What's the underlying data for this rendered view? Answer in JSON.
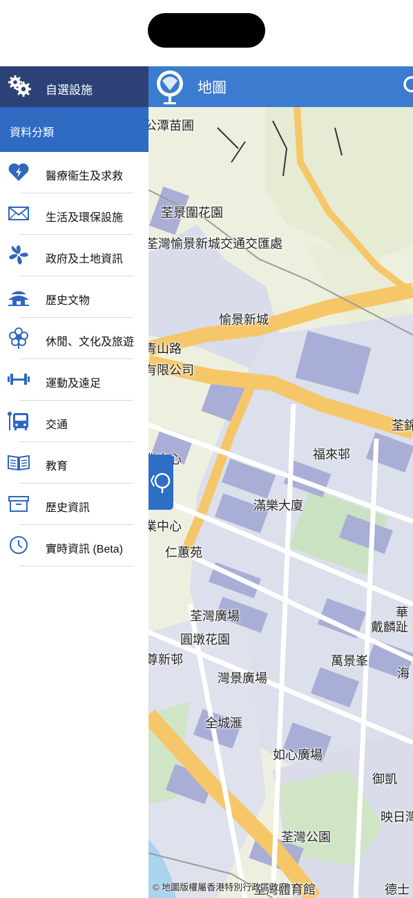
{
  "drawer": {
    "header_title": "自選設施",
    "category_label": "資料分類",
    "items": [
      {
        "label": "醫療衞生及求救",
        "icon": "medical-heart-icon"
      },
      {
        "label": "生活及環保設施",
        "icon": "envelope-icon"
      },
      {
        "label": "政府及土地資訊",
        "icon": "bauhinia-icon"
      },
      {
        "label": "歷史文物",
        "icon": "pagoda-icon"
      },
      {
        "label": "休閒、文化及旅遊",
        "icon": "flower-icon"
      },
      {
        "label": "運動及遠足",
        "icon": "dumbbell-icon"
      },
      {
        "label": "交通",
        "icon": "bus-stop-icon"
      },
      {
        "label": "教育",
        "icon": "book-icon"
      },
      {
        "label": "歷史資訊",
        "icon": "archive-box-icon"
      },
      {
        "label": "實時資訊 (Beta)",
        "icon": "clock-icon"
      }
    ]
  },
  "map": {
    "title": "地圖",
    "copyright": "© 地圖版權屬香港特別行政區政府",
    "labels": [
      "公潭苗圃",
      "荃景圍花園",
      "荃灣愉景新城交通交匯處",
      "愉景新城",
      "青山路",
      "有限公司",
      "荃錦",
      "福來邨",
      "業中心",
      "滿樂大廈",
      "業中心",
      "仁蕙苑",
      "華",
      "戴麟趾",
      "荃灣廣場",
      "圓墩花園",
      "萬景峯",
      "海",
      "尊新邨",
      "灣景廣場",
      "全城滙",
      "如心廣場",
      "御凱",
      "映日灣",
      "荃灣公園",
      "荃灣體育館",
      "德士"
    ]
  },
  "colors": {
    "drawer_header": "#2c4276",
    "category_bar": "#2f6ac3",
    "map_topbar": "#3b7bd0",
    "icon_blue": "#2f66c0"
  }
}
